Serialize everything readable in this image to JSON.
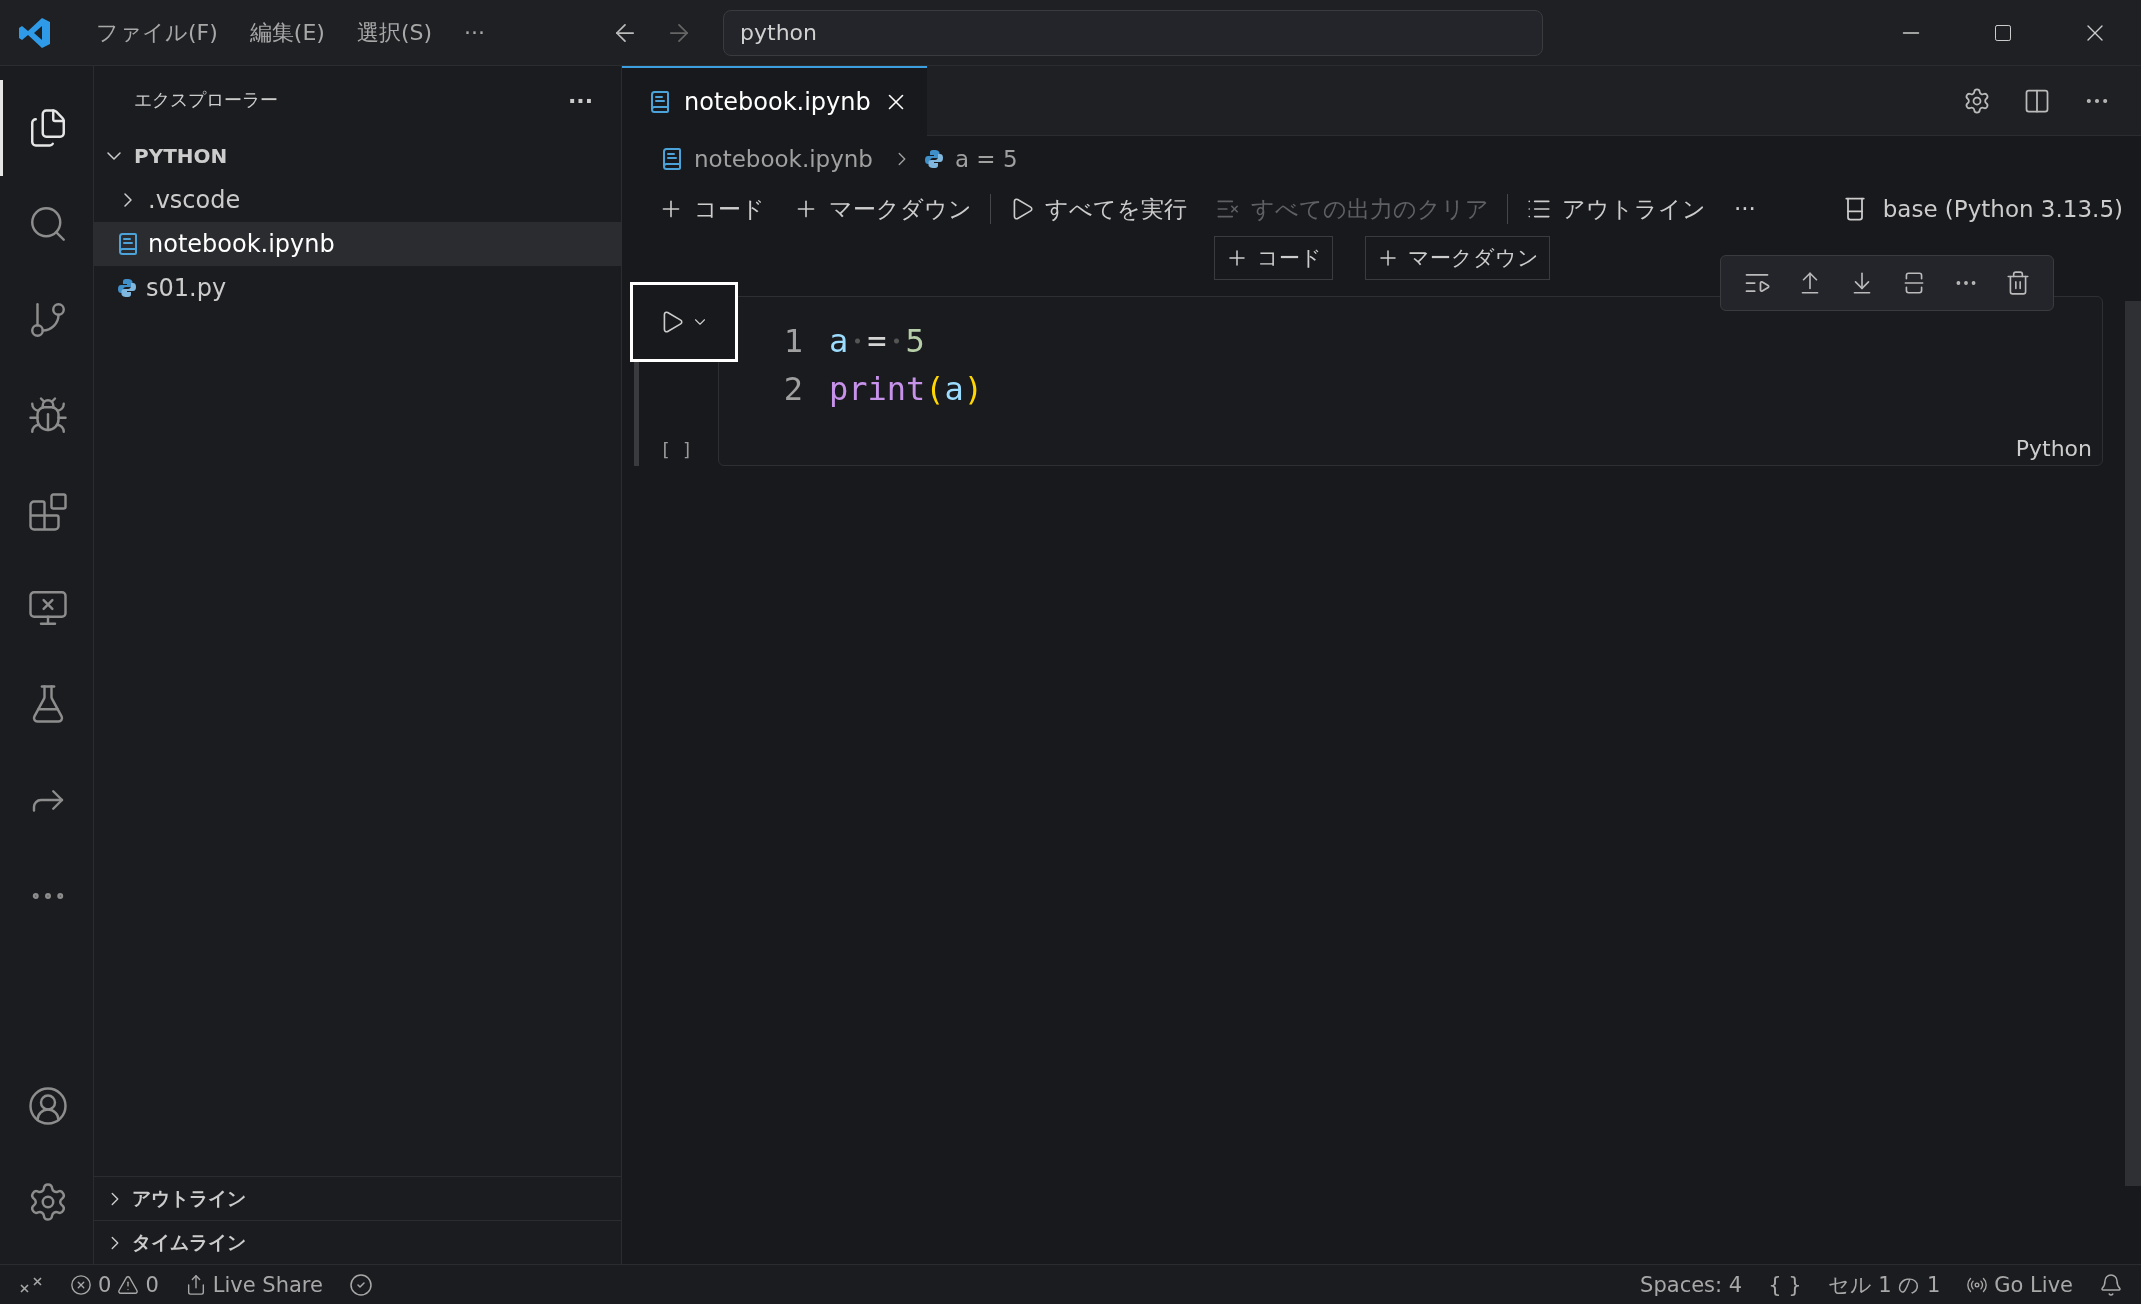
{
  "title_bar": {
    "menu": [
      "ファイル(F)",
      "編集(E)",
      "選択(S)",
      "···"
    ],
    "command_center": "python"
  },
  "activity_bar": [
    {
      "kind": "explorer",
      "selected": true
    },
    {
      "kind": "search",
      "selected": false
    },
    {
      "kind": "source_control",
      "selected": false
    },
    {
      "kind": "run_debug",
      "selected": false
    },
    {
      "kind": "extensions",
      "selected": false
    },
    {
      "kind": "remote",
      "selected": false
    },
    {
      "kind": "testing",
      "selected": false
    },
    {
      "kind": "live_share",
      "selected": false
    },
    {
      "kind": "more",
      "selected": false
    },
    {
      "kind": "account",
      "selected": false
    },
    {
      "kind": "settings",
      "selected": false
    }
  ],
  "sidebar": {
    "title": "エクスプローラー",
    "more": "···",
    "folder": {
      "name": "PYTHON",
      "expanded": true,
      "children": [
        {
          "name": ".vscode",
          "kind": "folder",
          "expanded": false,
          "selected": false
        },
        {
          "name": "notebook.ipynb",
          "kind": "notebook",
          "selected": true
        },
        {
          "name": "s01.py",
          "kind": "python",
          "selected": false
        }
      ]
    },
    "sections": [
      {
        "label": "アウトライン",
        "expanded": false
      },
      {
        "label": "タイムライン",
        "expanded": false
      }
    ]
  },
  "tabs": [
    {
      "label": "notebook.ipynb",
      "selected": true
    }
  ],
  "breadcrumbs": [
    {
      "label": "notebook.ipynb",
      "kind": "notebook"
    },
    {
      "label": "a = 5",
      "kind": "python"
    }
  ],
  "notebook_toolbar": {
    "items": [
      {
        "label": "コード",
        "kind": "add",
        "disabled": false
      },
      {
        "label": "マークダウン",
        "kind": "add",
        "disabled": false
      },
      {
        "label": "すべてを実行",
        "kind": "run",
        "disabled": false
      },
      {
        "label": "すべての出力のクリア",
        "kind": "clear",
        "disabled": true
      },
      {
        "label": "アウトライン",
        "kind": "outline",
        "disabled": false
      },
      {
        "label": "···",
        "kind": "more",
        "disabled": false
      }
    ],
    "kernel": "base (Python 3.13.5)"
  },
  "insert_buttons": [
    "コード",
    "マークダウン"
  ],
  "cell": {
    "focused": true,
    "execution_count": "[ ]",
    "language": "Python",
    "lines": [
      {
        "number": "1",
        "tokens": [
          {
            "text": "a",
            "kind": "variable"
          },
          {
            "text": "=",
            "kind": "operator",
            "space_before": true
          },
          {
            "text": "5",
            "kind": "number",
            "space_before": true
          }
        ]
      },
      {
        "number": "2",
        "tokens": [
          {
            "text": "print",
            "kind": "function"
          },
          {
            "text": "(",
            "kind": "bracket"
          },
          {
            "text": "a",
            "kind": "variable"
          },
          {
            "text": ")",
            "kind": "bracket"
          }
        ]
      }
    ]
  },
  "status_bar": {
    "errors": "0",
    "warnings": "0",
    "live_share": "Live Share",
    "spaces": "Spaces: 4",
    "braces": "{ }",
    "cell_position": "セル 1 の 1",
    "go_live": "Go Live"
  }
}
